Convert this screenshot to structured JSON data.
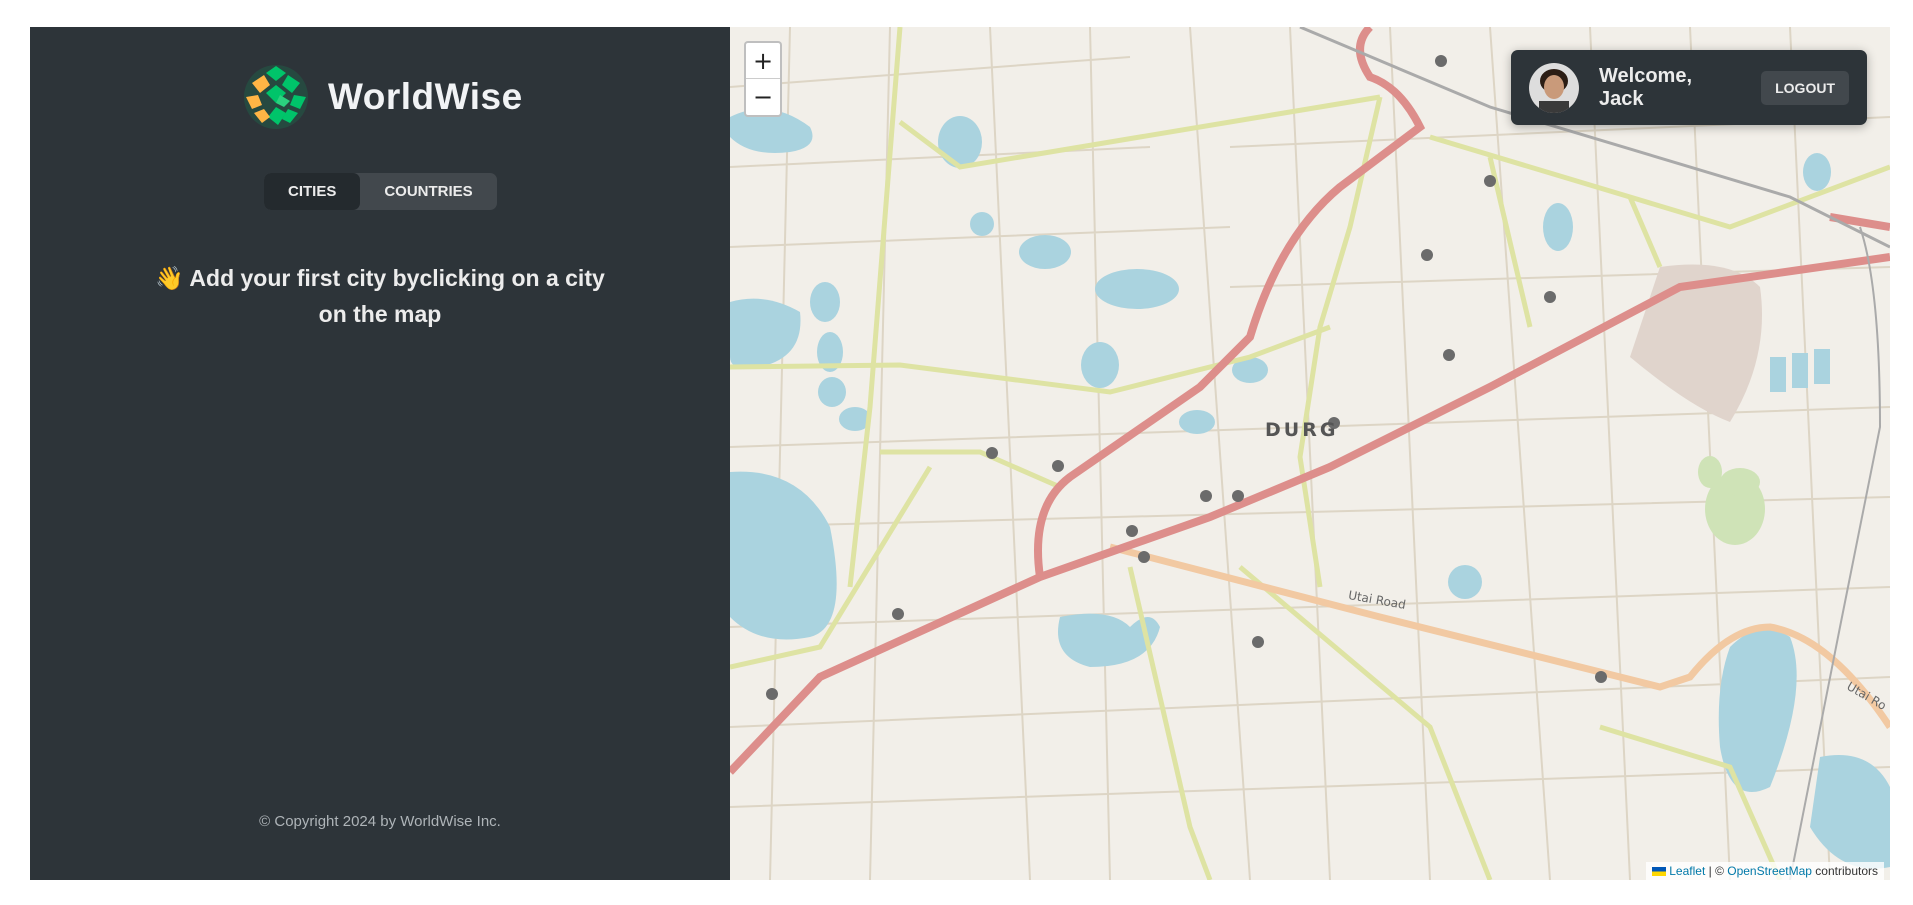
{
  "sidebar": {
    "logo_text": "WorldWise",
    "tabs": [
      {
        "label": "CITIES",
        "active": true
      },
      {
        "label": "COUNTRIES",
        "active": false
      }
    ],
    "message_emoji": "👋",
    "message": "Add your first city byclicking on a city on the map",
    "copyright": "© Copyright 2024 by WorldWise Inc."
  },
  "map": {
    "zoom_in": "+",
    "zoom_out": "−",
    "place_label": "DURG",
    "road_labels": [
      "Utai Road",
      "Utai Ro"
    ],
    "attribution": {
      "leaflet": "Leaflet",
      "separator": " | © ",
      "osm": "OpenStreetMap",
      "suffix": " contributors"
    }
  },
  "user": {
    "welcome": "Welcome, Jack",
    "logout": "LOGOUT"
  },
  "colors": {
    "sidebar_bg": "#2d3439",
    "brand_green": "#00c46a",
    "brand_orange": "#ffb545",
    "map_bg": "#f2efe9",
    "water": "#aad3df",
    "primary_road": "#e8a0a0"
  },
  "icons": [
    "globe-logo-icon",
    "waving-hand-icon",
    "user-avatar-icon",
    "zoom-in-icon",
    "zoom-out-icon",
    "ukraine-flag-icon"
  ]
}
